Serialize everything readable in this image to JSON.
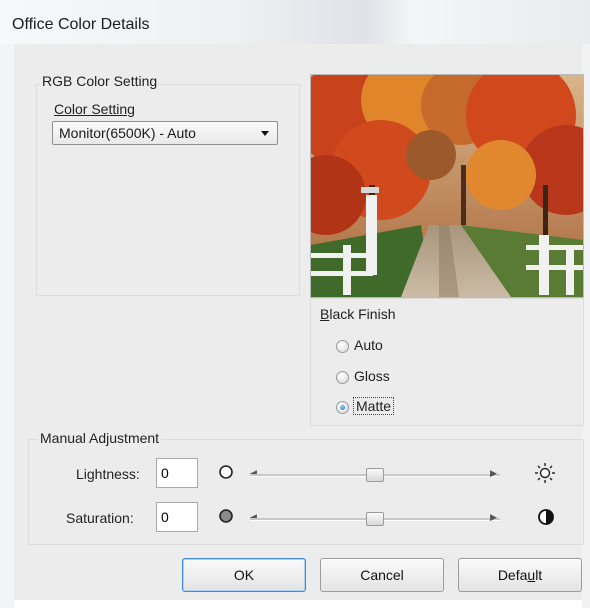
{
  "window": {
    "title": "Office Color Details"
  },
  "rgb_group": {
    "label": "RGB Color Setting",
    "color_setting_label": "Color Setting",
    "color_setting_value": "Monitor(6500K) - Auto"
  },
  "preview": {
    "description_icon": "autumn-road-photo"
  },
  "black_finish": {
    "label": "Black Finish",
    "options": [
      "Auto",
      "Gloss",
      "Matte"
    ],
    "selected": "Matte"
  },
  "manual_adjustment": {
    "label": "Manual Adjustment",
    "lightness": {
      "label": "Lightness:",
      "value": "0",
      "slider_fraction": 0.5
    },
    "saturation": {
      "label": "Saturation:",
      "value": "0",
      "slider_fraction": 0.5
    }
  },
  "buttons": {
    "ok": "OK",
    "cancel": "Cancel",
    "default": "Default"
  },
  "colors": {
    "accent": "#3c8ad8",
    "dialog_bg": "#ececec"
  }
}
